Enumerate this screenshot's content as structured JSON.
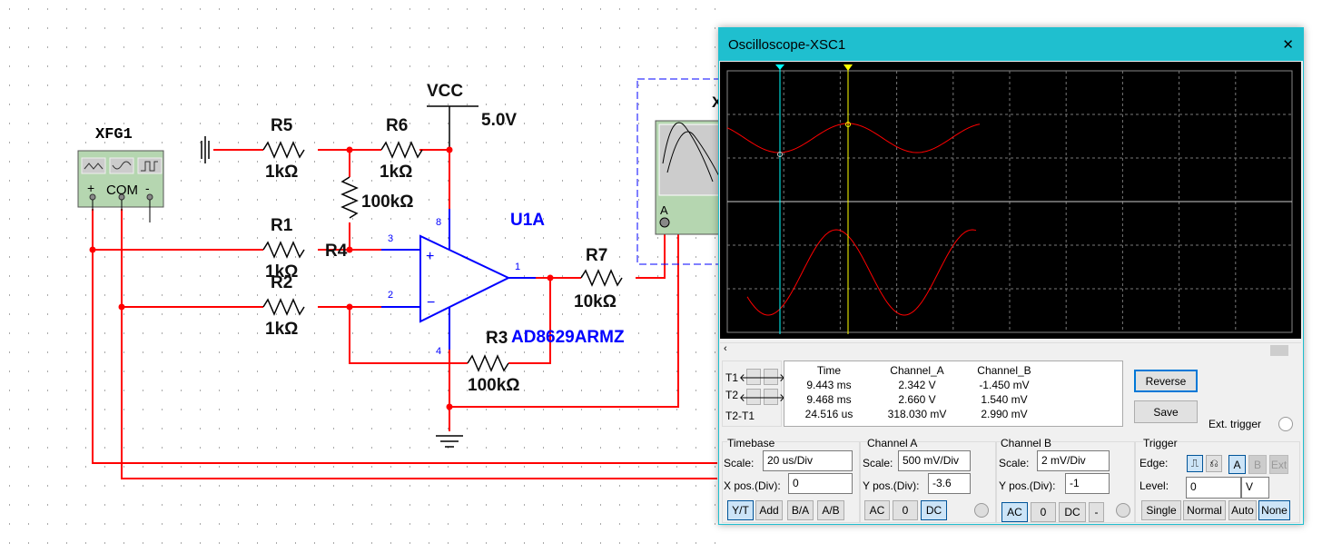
{
  "schematic": {
    "xfg": {
      "label": "XFG1",
      "pins": [
        "+",
        "COM",
        "-"
      ]
    },
    "vcc": {
      "label": "VCC",
      "value": "5.0V"
    },
    "resistors": [
      {
        "ref": "R5",
        "value": "1kΩ"
      },
      {
        "ref": "R6",
        "value": "1kΩ"
      },
      {
        "ref": "R4",
        "value": "100kΩ"
      },
      {
        "ref": "R1",
        "value": "1kΩ"
      },
      {
        "ref": "R2",
        "value": "1kΩ"
      },
      {
        "ref": "R3",
        "value": "100kΩ"
      },
      {
        "ref": "R7",
        "value": "10kΩ"
      }
    ],
    "opamp": {
      "ref": "U1A",
      "part": "AD8629ARMZ",
      "pins": [
        "3",
        "2",
        "1",
        "8",
        "4"
      ]
    },
    "scope_icon": {
      "ref": "X",
      "pin_a": "A"
    },
    "colors": {
      "wire": "#ff0000",
      "part": "#0000ff"
    }
  },
  "scope": {
    "title": "Oscilloscope-XSC1",
    "colors": {
      "trace_a": "#ff0000",
      "trace_b": "#ff0000",
      "cursor_t1": "#00ffff",
      "cursor_t2": "#ffff00",
      "titlebar": "#1fbfcf"
    },
    "cursors": {
      "t1": "1",
      "t2": "2"
    },
    "measure": {
      "headers": [
        "Time",
        "Channel_A",
        "Channel_B"
      ],
      "rows": [
        {
          "label": "T1",
          "time": "9.443 ms",
          "a": "2.342 V",
          "b": "-1.450 mV"
        },
        {
          "label": "T2",
          "time": "9.468 ms",
          "a": "2.660 V",
          "b": "1.540 mV"
        },
        {
          "label": "T2-T1",
          "time": "24.516 us",
          "a": "318.030 mV",
          "b": "2.990 mV"
        }
      ]
    },
    "reverse": "Reverse",
    "save": "Save",
    "ext_trigger": "Ext. trigger",
    "timebase": {
      "title": "Timebase",
      "scale_label": "Scale:",
      "scale": "20 us/Div",
      "xpos_label": "X pos.(Div):",
      "xpos": "0",
      "modes": [
        "Y/T",
        "Add",
        "B/A",
        "A/B"
      ],
      "active": "Y/T"
    },
    "channel_a": {
      "title": "Channel A",
      "scale_label": "Scale:",
      "scale": "500 mV/Div",
      "ypos_label": "Y pos.(Div):",
      "ypos": "-3.6",
      "coupling": [
        "AC",
        "0",
        "DC"
      ],
      "active": "DC"
    },
    "channel_b": {
      "title": "Channel B",
      "scale_label": "Scale:",
      "scale": "2 mV/Div",
      "ypos_label": "Y pos.(Div):",
      "ypos": "-1",
      "coupling": [
        "AC",
        "0",
        "DC",
        "-"
      ],
      "active": "AC"
    },
    "trigger": {
      "title": "Trigger",
      "edge_label": "Edge:",
      "sources": [
        "A",
        "B",
        "Ext"
      ],
      "level_label": "Level:",
      "level": "0",
      "unit": "V",
      "modes": [
        "Single",
        "Normal",
        "Auto",
        "None"
      ],
      "active": "None"
    }
  }
}
